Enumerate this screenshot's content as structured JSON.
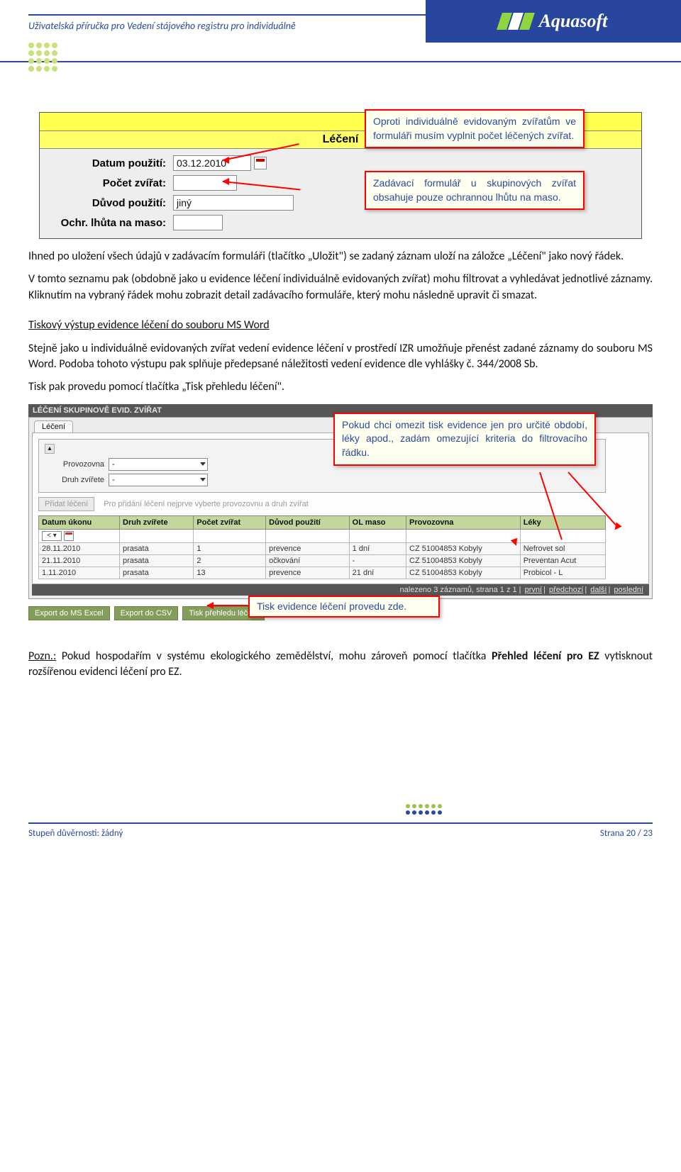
{
  "header": {
    "doc_title": "Uživatelská příručka pro Vedení stájového registru pro individuálně",
    "brand": "Aquasoft"
  },
  "form": {
    "title": "Léčení",
    "rows": {
      "date_label": "Datum použití:",
      "date_value": "03.12.2010",
      "count_label": "Počet zvířat:",
      "count_value": "",
      "reason_label": "Důvod použití:",
      "reason_value": "jiný",
      "ochr_label": "Ochr. lhůta na maso:"
    },
    "callout1": "Oproti individuálně evidovaným zvířatům ve formuláři musím vyplnit počet léčených zvířat.",
    "callout2": "Zadávací formulář u skupinových zvířat obsahuje pouze ochrannou lhůtu na maso."
  },
  "paragraphs": {
    "p1": "Ihned po uložení všech údajů v zadávacím formuláři (tlačítko „Uložit\") se zadaný záznam uloží na záložce „Léčení\" jako nový řádek.",
    "p2": "V tomto seznamu pak (obdobně jako u evidence léčení individuálně evidovaných zvířat) mohu filtrovat a vyhledávat jednotlivé záznamy. Kliknutím na vybraný řádek mohu zobrazit detail zadávacího formuláře, který mohu následně upravit či smazat.",
    "h3": "Tiskový výstup evidence léčení do souboru MS Word",
    "p3": "Stejně jako u individuálně evidovaných zvířat vedení evidence léčení v prostředí IZR umožňuje přenést zadané záznamy do souboru MS Word. Podoba tohoto výstupu pak splňuje předepsané náležitosti vedení evidence dle vyhlášky č. 344/2008 Sb.",
    "p4": "Tisk pak provedu pomocí tlačítka „Tisk přehledu léčení\"."
  },
  "table_shot": {
    "titlebar": "LÉČENÍ SKUPINOVĚ EVID. ZVÍŘAT",
    "tab": "Léčení",
    "filter_top": {
      "provozovna_label": "Provozovna",
      "provozovna_value": "-",
      "druh_label": "Druh zvířete",
      "druh_value": "-"
    },
    "add_disabled": "Přidat léčení",
    "add_hint": "Pro přidání léčení nejprve vyberte provozovnu a druh zvířat",
    "columns": [
      "Datum úkonu",
      "Druh zvířete",
      "Počet zvířat",
      "Důvod použití",
      "OL maso",
      "Provozovna",
      "Léky"
    ],
    "filter_op": "< ▾",
    "rows": [
      {
        "date": "28.11.2010",
        "druh": "prasata",
        "pocet": "1",
        "duvod": "prevence",
        "ol": "1 dní",
        "prov": "CZ 51004853 Kobyly",
        "leky": "Nefrovet sol"
      },
      {
        "date": "21.11.2010",
        "druh": "prasata",
        "pocet": "2",
        "duvod": "očkování",
        "ol": "-",
        "prov": "CZ 51004853 Kobyly",
        "leky": "Preventan Acut"
      },
      {
        "date": "1.11.2010",
        "druh": "prasata",
        "pocet": "13",
        "duvod": "prevence",
        "ol": "21 dní",
        "prov": "CZ 51004853 Kobyly",
        "leky": "Probicol - L"
      }
    ],
    "status_l": "nalezeno 3 záznamů, strana 1 z 1",
    "status_links": [
      "první",
      "předchozí",
      "další",
      "poslední"
    ],
    "exports": [
      "Export do MS Excel",
      "Export do CSV",
      "Tisk přehledu léčení"
    ],
    "callout3": "Pokud chci omezit tisk evidence jen pro určité období, léky apod., zadám omezující kriteria do filtrovacího řádku.",
    "callout4": "Tisk evidence léčení provedu zde."
  },
  "note": {
    "lead": "Pozn.:",
    "text_a": " Pokud hospodařím v systému ekologického zemědělství, mohu zároveň pomocí tlačítka ",
    "bold": "Přehled léčení pro EZ",
    "text_b": " vytisknout rozšířenou evidenci léčení pro EZ."
  },
  "footer": {
    "left": "Stupeň důvěrnosti: žádný",
    "right_label": "Strana ",
    "right_page": "20 / 23"
  }
}
